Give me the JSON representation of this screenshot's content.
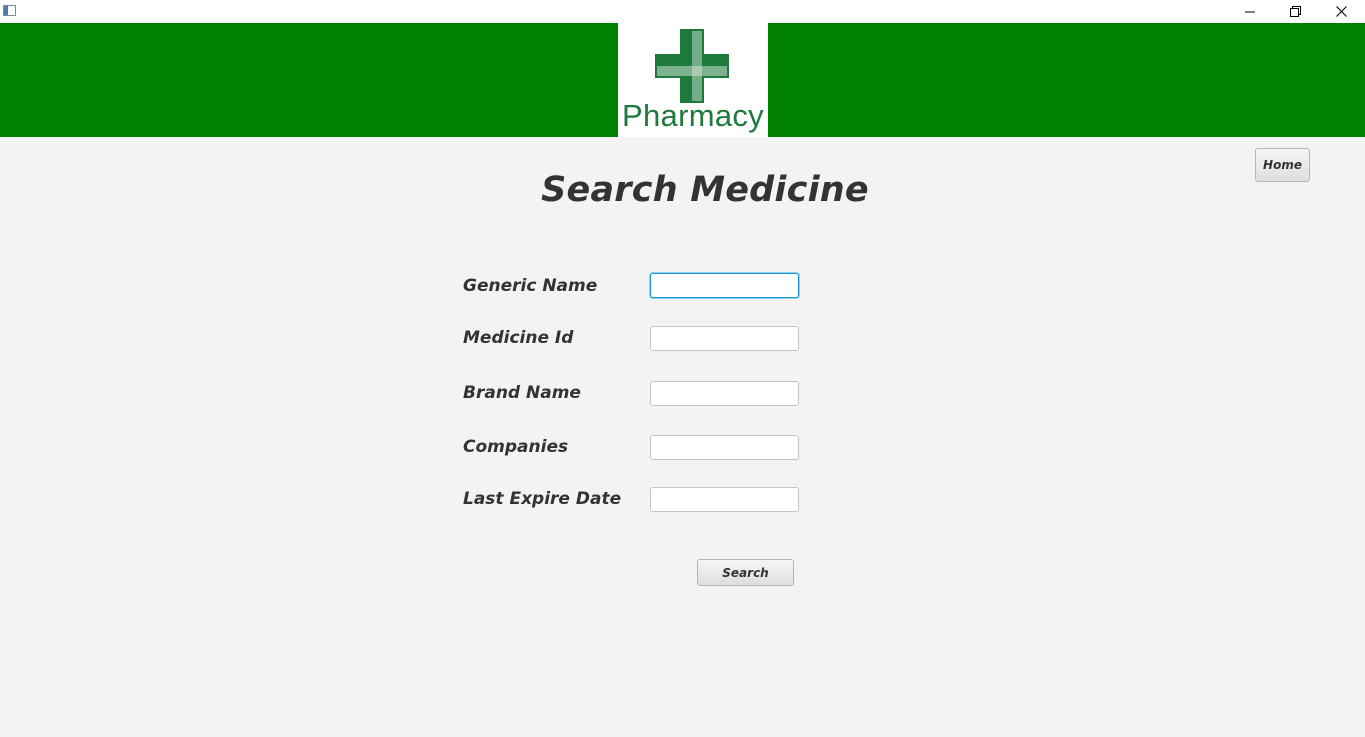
{
  "window": {
    "minimize_icon": "minimize-icon",
    "maximize_icon": "restore-icon",
    "close_icon": "close-icon"
  },
  "header": {
    "background_color": "#008000",
    "logo_text": "Pharmacy",
    "logo_icon": "pharmacy-cross-icon",
    "logo_color": "#1e7a3a"
  },
  "nav": {
    "home_label": "Home"
  },
  "page": {
    "title": "Search Medicine"
  },
  "form": {
    "fields": [
      {
        "label": "Generic Name",
        "value": "",
        "focused": true
      },
      {
        "label": "Medicine Id",
        "value": ""
      },
      {
        "label": "Brand Name",
        "value": ""
      },
      {
        "label": "Companies",
        "value": ""
      },
      {
        "label": "Last Expire Date",
        "value": ""
      }
    ],
    "search_label": "Search"
  }
}
